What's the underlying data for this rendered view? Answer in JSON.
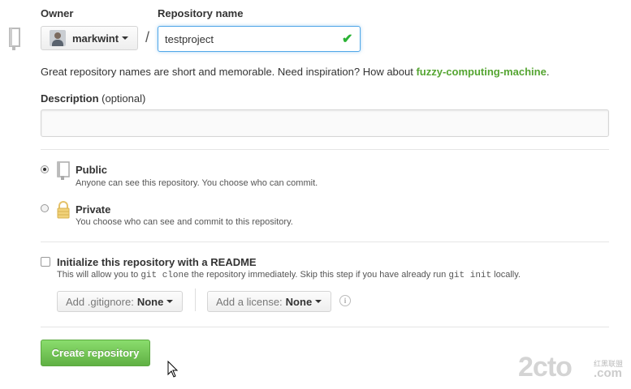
{
  "owner": {
    "label": "Owner",
    "selected": "markwint"
  },
  "repo_name": {
    "label": "Repository name",
    "separator": "/",
    "value": "testproject"
  },
  "hint": {
    "text": "Great repository names are short and memorable. Need inspiration? How about ",
    "suggestion": "fuzzy-computing-machine",
    "suffix": "."
  },
  "description": {
    "label": "Description",
    "optional": "(optional)",
    "value": ""
  },
  "visibility": {
    "selected": "public",
    "public": {
      "title": "Public",
      "subtitle": "Anyone can see this repository. You choose who can commit."
    },
    "private": {
      "title": "Private",
      "subtitle": "You choose who can see and commit to this repository."
    }
  },
  "readme": {
    "checked": false,
    "label": "Initialize this repository with a README",
    "help_prefix": "This will allow you to ",
    "help_code1": "git clone",
    "help_middle": " the repository immediately. Skip this step if you have already run ",
    "help_code2": "git init",
    "help_suffix": " locally."
  },
  "gitignore": {
    "label": "Add .gitignore:",
    "value": "None"
  },
  "license": {
    "label": "Add a license:",
    "value": "None"
  },
  "create_button": "Create repository",
  "watermark": {
    "logo": "2cto",
    "sub": "红黑联盟",
    "domain": ".com"
  },
  "colors": {
    "accent_green": "#55a532",
    "button_green": "#60b044",
    "focus_blue": "#51a7e8",
    "valid_check": "#2ab234"
  },
  "icons": [
    "repo-icon",
    "avatar",
    "chevron-down-icon",
    "check-icon",
    "lock-icon",
    "info-icon",
    "mouse-cursor"
  ]
}
